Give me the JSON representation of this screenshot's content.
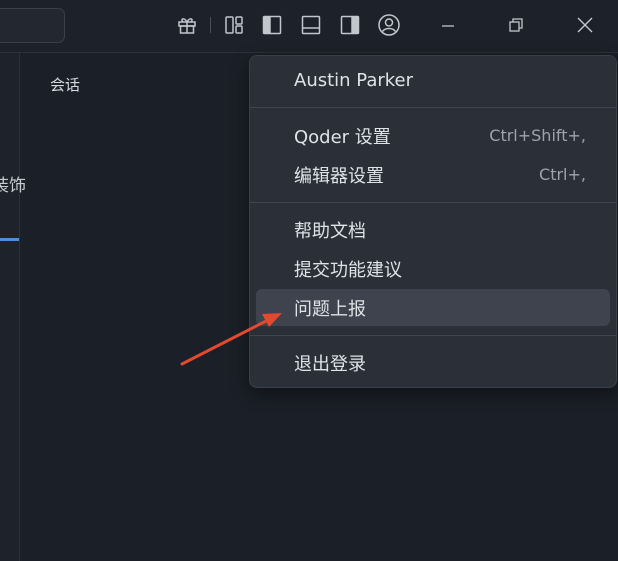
{
  "session": {
    "label": "会话"
  },
  "left_strip": {
    "label": "装饰"
  },
  "menu": {
    "user": "Austin Parker",
    "items": [
      {
        "label": "Qoder 设置",
        "shortcut": "Ctrl+Shift+,"
      },
      {
        "label": "编辑器设置",
        "shortcut": "Ctrl+,"
      },
      {
        "label": "帮助文档",
        "shortcut": ""
      },
      {
        "label": "提交功能建议",
        "shortcut": ""
      },
      {
        "label": "问题上报",
        "shortcut": ""
      },
      {
        "label": "退出登录",
        "shortcut": ""
      }
    ],
    "highlighted": "问题上报"
  },
  "colors": {
    "arrow": "#e2492f",
    "accent": "#4f8fd6"
  },
  "icons": [
    "gift-icon",
    "layout-icon",
    "toggle-left-panel-icon",
    "toggle-bottom-panel-icon",
    "toggle-right-panel-icon",
    "account-icon",
    "minimize-icon",
    "restore-icon",
    "close-icon"
  ]
}
